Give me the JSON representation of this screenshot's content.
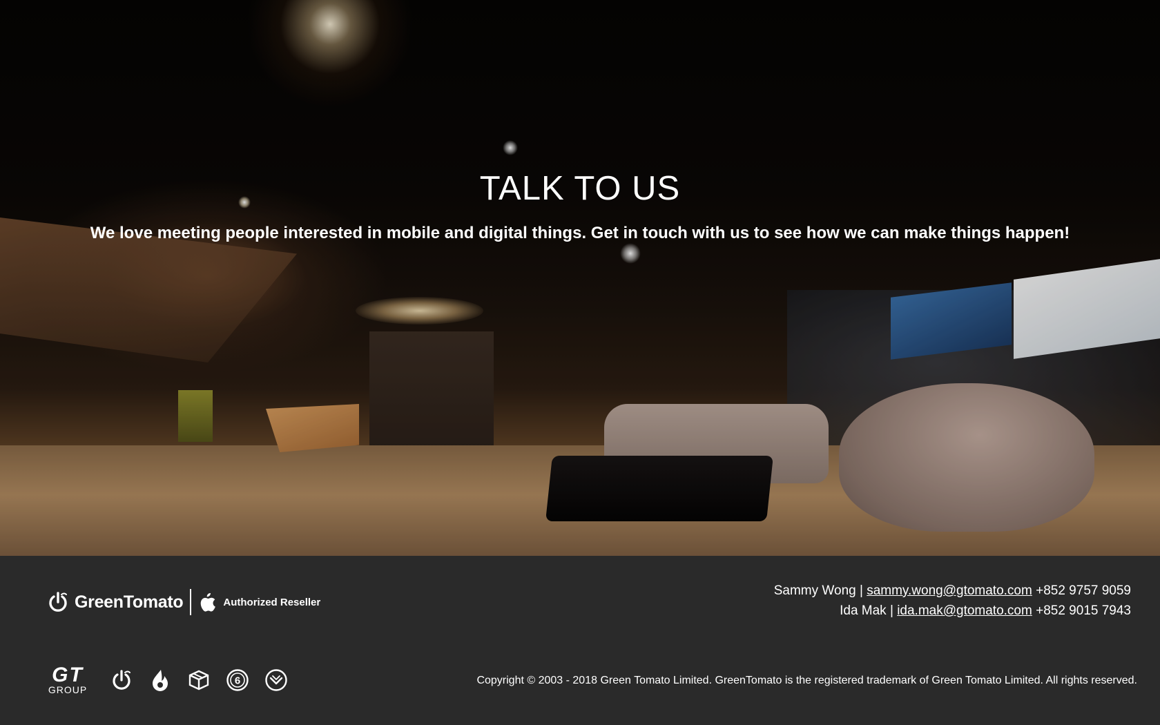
{
  "hero": {
    "title": "TALK TO US",
    "subtitle": "We love meeting people interested in mobile and digital things. Get in touch with us to see how we can make things happen!"
  },
  "footer": {
    "brand": {
      "name": "GreenTomato",
      "reseller_label": "Authorized Reseller",
      "logo_icon": "power-icon",
      "apple_icon": "apple-icon"
    },
    "contacts": [
      {
        "name": "Sammy Wong",
        "separator": "|",
        "email": "sammy.wong@gtomato.com",
        "phone": "+852 9757 9059"
      },
      {
        "name": "Ida Mak",
        "separator": "|",
        "email": "ida.mak@gtomato.com",
        "phone": "+852 9015 7943"
      }
    ],
    "group": {
      "letters": "GT",
      "word": "GROUP",
      "icons": [
        "greentomato-power-icon",
        "flame-drop-icon",
        "box-icon",
        "number-six-circle-icon",
        "shield-check-circle-icon"
      ]
    },
    "copyright": "Copyright © 2003 - 2018 Green Tomato Limited. GreenTomato is the registered trademark of Green Tomato Limited. All rights reserved."
  },
  "colors": {
    "footer_bg": "#2a2a2a",
    "text": "#ffffff"
  }
}
